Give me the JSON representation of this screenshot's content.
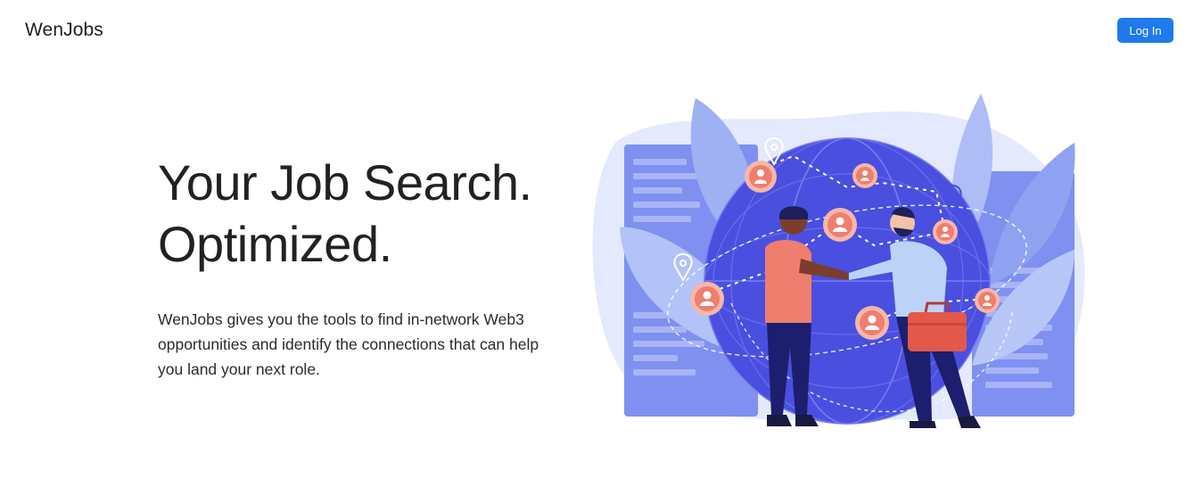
{
  "navbar": {
    "brand": "WenJobs",
    "login_label": "Log In"
  },
  "hero": {
    "headline_line1": "Your Job Search.",
    "headline_line2": "Optimized.",
    "lead": "WenJobs gives you the tools to find in-network Web3 opportunities and identify the connections that can help you land your next role."
  },
  "colors": {
    "accent": "#1f7aec",
    "globe": "#4a4fe0",
    "leaf": "#a9b9f5",
    "panel": "#7d8ff0",
    "profile_pin": "#f07e6e",
    "briefcase": "#e4584a"
  },
  "icons": {
    "illustration": "handshake-globe-illustration",
    "pin": "location-pin-icon",
    "profile": "user-profile-icon"
  }
}
